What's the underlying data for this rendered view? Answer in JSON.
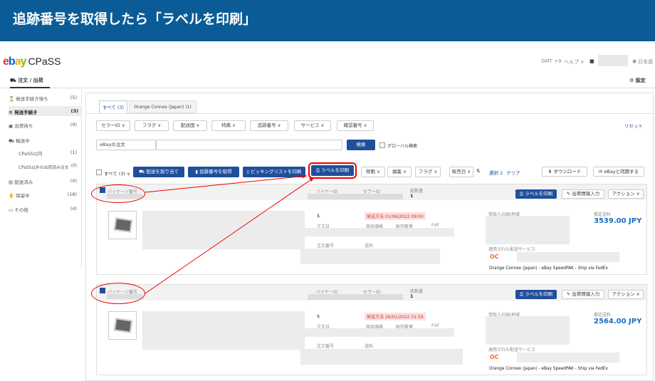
{
  "banner": {
    "title": "追跡番号を取得したら「ラベルを印刷」"
  },
  "header": {
    "logo_cpass": "CPaSS",
    "gmt": "GMT +9",
    "help": "ヘルプ ∨",
    "lang": "日本語"
  },
  "nav": {
    "orders_tab": "注文 / 出荷",
    "settings": "設定"
  },
  "sidebar": {
    "items": [
      {
        "label": "発送手続き待ち",
        "count": "(5)"
      },
      {
        "label": "発送手続き",
        "count": "(3)"
      },
      {
        "label": "出荷待ち",
        "count": "(9)"
      },
      {
        "label": "輸送中",
        "count": ""
      },
      {
        "label": "CPaSS以内",
        "count": "(1)"
      },
      {
        "label": "CPaSS以外の出荷済み注文",
        "count": "(0)"
      },
      {
        "label": "配送済み",
        "count": "(0)"
      },
      {
        "label": "保留中",
        "count": "(18)"
      },
      {
        "label": "その他",
        "count": "(4)"
      }
    ]
  },
  "tabs": [
    "すべて (3)",
    "Orange Connex (Japan) (1)"
  ],
  "filters": [
    "セラーID ∨",
    "フラグ ∨",
    "配送国 ∨",
    "特典 ∨",
    "追跡番号 ∨",
    "サービス ∨",
    "確認番号 ∨"
  ],
  "reset": "リセット",
  "search": {
    "select": "eBayの注文",
    "button": "検索",
    "global": "グローバル検索"
  },
  "toolbar": {
    "all": "すべて (3) ∨",
    "assign": "配送を割り当て",
    "get_tracking": "追跡番号を取得",
    "picking": "ピッキングリストを印刷",
    "print_label": "ラベルを印刷",
    "move": "移動 ∨",
    "edit": "編集 ∨",
    "flag": "フラグ ∨",
    "sort": "販売日 ∨",
    "selected": "選択 2",
    "clear": "クリア",
    "download": "ダウンロード",
    "sync": "eBayと同期する"
  },
  "orders": [
    {
      "package_label": "パッケージ番号",
      "buyer_id_label": "バイヤーID",
      "seller_id_label": "セラーID",
      "qty_label": "総数量",
      "qty": "1",
      "print_btn": "ラベルを印刷",
      "ship_info_btn": "出荷情報入力",
      "actions_btn": "アクション ∨",
      "dollar": "$",
      "deadline": "発送方法 01/06/2022 09:00",
      "order_date_label": "注文日",
      "price_label": "商品価格",
      "sold_qty_label": "販売数量",
      "fvf": "FVF",
      "order_no_label": "注文番号",
      "shipping_fee_label": "送料",
      "recipient_label": "受取人の国/地域",
      "est_shipping_label": "推定送料",
      "est_shipping": "3539.00 JPY",
      "applied_service_label": "適用された配送サービス",
      "service_name": "Orange Connex (Japan) - eBay SpeedPAK - Ship via FedEx"
    },
    {
      "package_label": "パッケージ番号",
      "buyer_id_label": "バイヤーID",
      "seller_id_label": "セラーID",
      "qty_label": "総数量",
      "qty": "1",
      "print_btn": "ラベルを印刷",
      "ship_info_btn": "出荷情報入力",
      "actions_btn": "アクション ∨",
      "dollar": "$",
      "deadline": "発送方法 26/01/2022 01:59",
      "order_date_label": "注文日",
      "price_label": "商品価格",
      "sold_qty_label": "販売数量",
      "fvf": "FVF",
      "order_no_label": "注文番号",
      "shipping_fee_label": "送料",
      "recipient_label": "受取人の国/地域",
      "est_shipping_label": "推定送料",
      "est_shipping": "2564.00 JPY",
      "applied_service_label": "適用された配送サービス",
      "service_name": "Orange Connex (Japan) - eBay SpeedPAK - Ship via FedEx"
    }
  ],
  "colors": {
    "banner": "#0b5c96",
    "primary": "#1f4f9c",
    "highlight": "#e00000",
    "price": "#1b6cc4"
  }
}
